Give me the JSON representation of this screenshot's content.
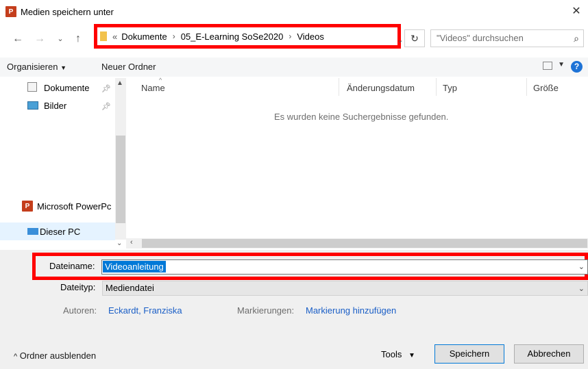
{
  "window": {
    "title": "Medien speichern unter",
    "app_badge": "P"
  },
  "address": {
    "prefix": "«",
    "crumbs": [
      "Dokumente",
      "05_E-Learning SoSe2020",
      "Videos"
    ],
    "separator": "›"
  },
  "search": {
    "placeholder": "\"Videos\" durchsuchen"
  },
  "toolbar": {
    "organize": "Organisieren",
    "new_folder": "Neuer Ordner",
    "help": "?"
  },
  "nav": {
    "items": [
      {
        "label": "Dokumente"
      },
      {
        "label": "Bilder"
      },
      {
        "label": "Microsoft PowerPc"
      },
      {
        "label": "Dieser PC"
      }
    ]
  },
  "list": {
    "columns": [
      "Name",
      "Änderungsdatum",
      "Typ",
      "Größe"
    ],
    "empty_message": "Es wurden keine Suchergebnisse gefunden."
  },
  "form": {
    "filename_label": "Dateiname:",
    "filename_value": "Videoanleitung",
    "filetype_label": "Dateityp:",
    "filetype_value": "Mediendatei",
    "authors_label": "Autoren:",
    "authors_value": "Eckardt, Franziska",
    "tags_label": "Markierungen:",
    "tags_value": "Markierung hinzufügen"
  },
  "footer": {
    "hide_folders": "Ordner ausblenden",
    "tools": "Tools",
    "save": "Speichern",
    "cancel": "Abbrechen"
  }
}
